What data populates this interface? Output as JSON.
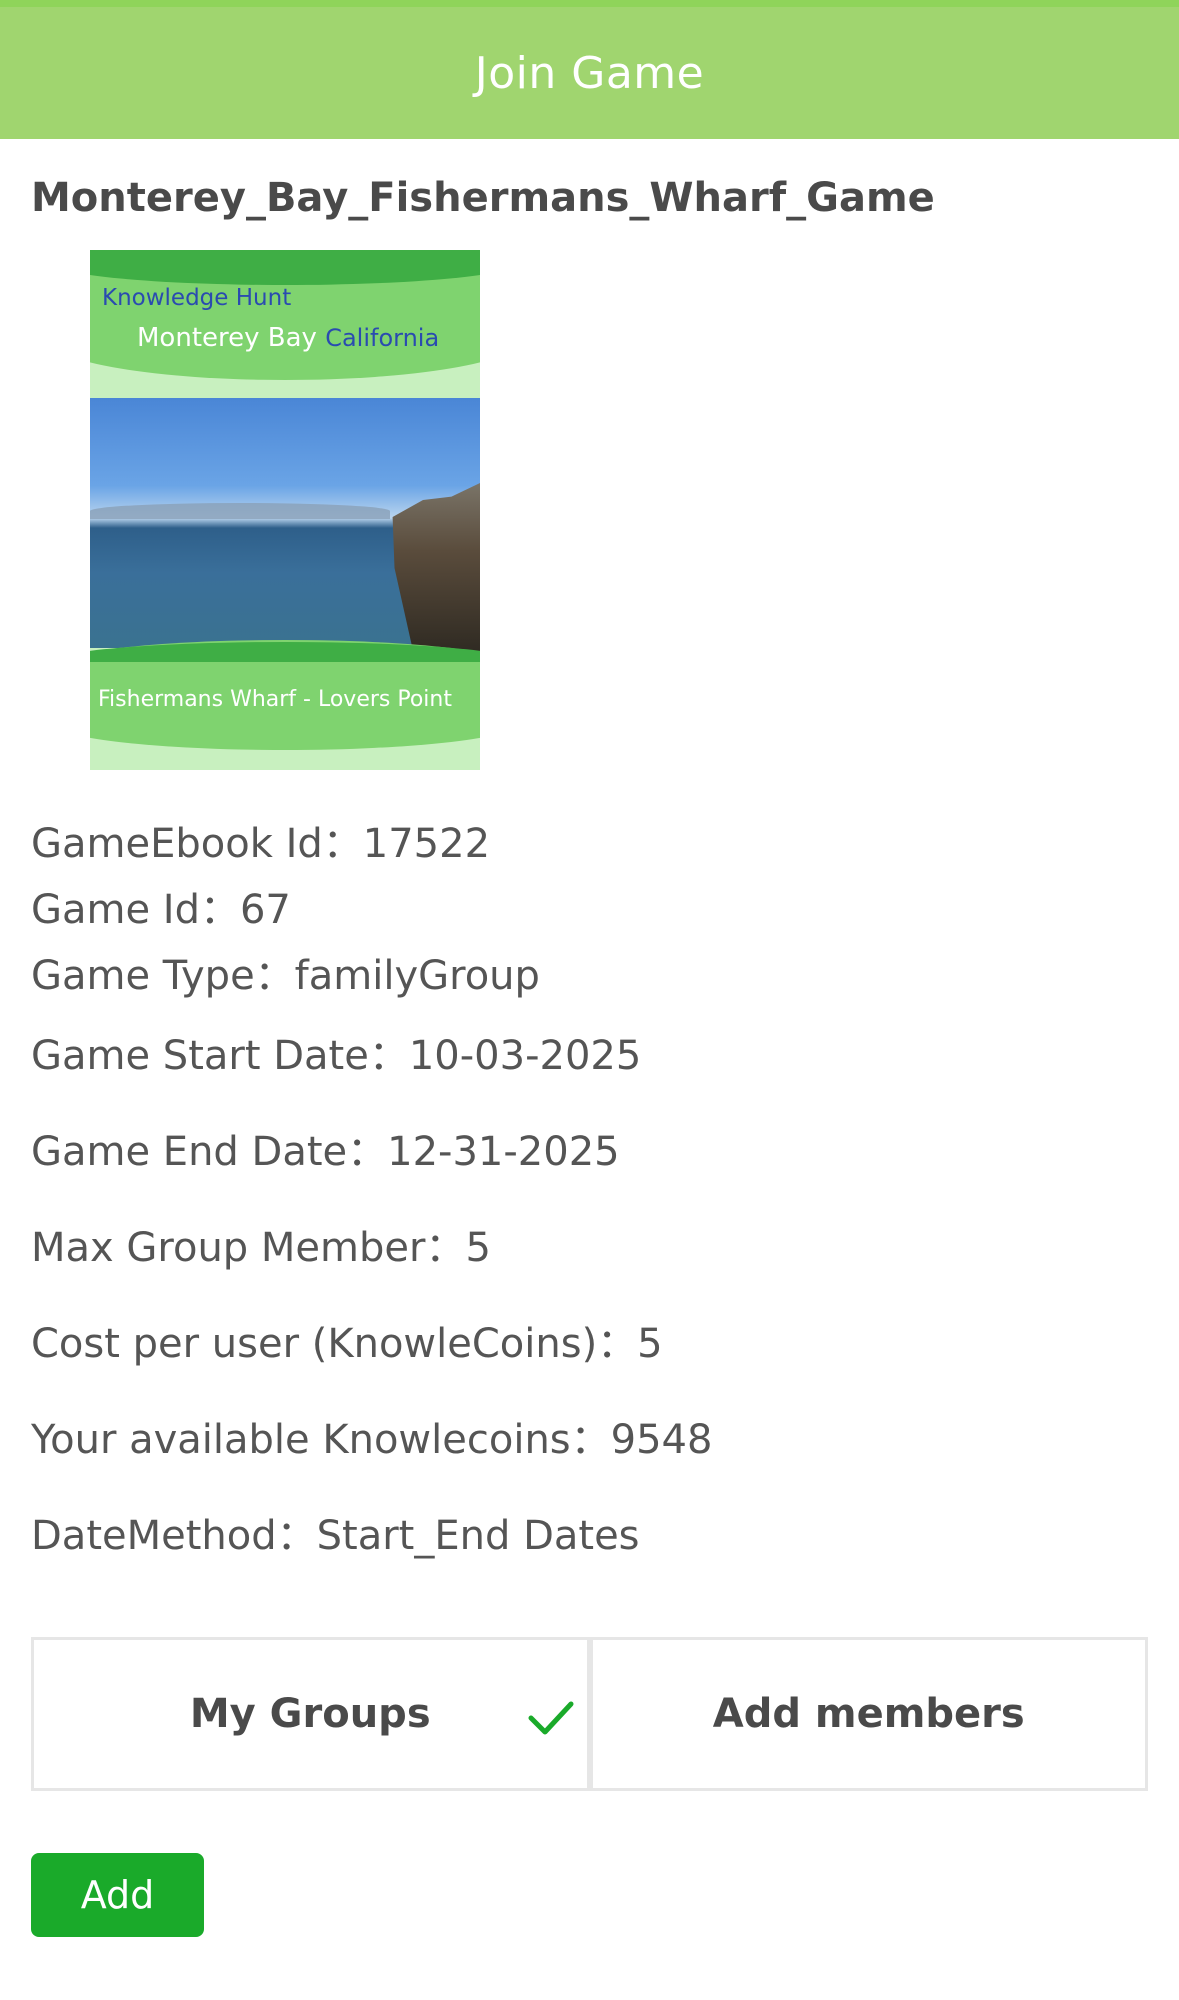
{
  "header": {
    "title": "Join Game"
  },
  "game": {
    "name": "Monterey_Bay_Fishermans_Wharf_Game",
    "cover": {
      "line1": "Knowledge Hunt",
      "line2_main": "Monterey Bay",
      "line2_accent": "California",
      "subtitle": "Fishermans Wharf - Lovers Point"
    },
    "info": [
      {
        "label": "GameEbook Id：",
        "value": "17522"
      },
      {
        "label": "Game Id：",
        "value": "67"
      },
      {
        "label": "Game Type：",
        "value": "familyGroup"
      },
      {
        "label": "Game Start Date：",
        "value": "10-03-2025"
      },
      {
        "label": "Game End Date：",
        "value": "12-31-2025"
      },
      {
        "label": "Max Group Member：",
        "value": "5"
      },
      {
        "label": "Cost per user (KnowleCoins)：",
        "value": "5"
      },
      {
        "label": "Your available Knowlecoins：",
        "value": "9548"
      },
      {
        "label": "DateMethod：",
        "value": "Start_End Dates"
      }
    ]
  },
  "tabs": [
    {
      "label": "My Groups",
      "selected": true
    },
    {
      "label": "Add members",
      "selected": false
    }
  ],
  "actions": {
    "add_label": "Add"
  },
  "colors": {
    "header": "#a0d56f",
    "button": "#1aaa2a",
    "check": "#1aaa2a"
  }
}
